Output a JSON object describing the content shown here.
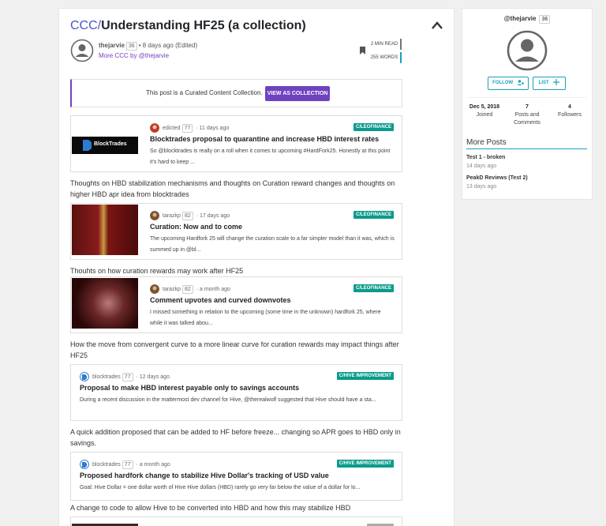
{
  "post": {
    "prefix": "CCC",
    "slash": "/",
    "title_rest": "Understanding HF25 (a collection)",
    "author": "thejarvie",
    "author_rep": "36",
    "age": "• 8 days ago (Edited)",
    "author_sub": "More CCC by @thejarvie",
    "read_time": "2 MIN READ",
    "word_count": "255 WORDS"
  },
  "notice": {
    "text": "This post is a Curated Content Collection.",
    "button": "VIEW AS COLLECTION"
  },
  "cards": [
    {
      "author": "edicted",
      "rep": "77",
      "age": "11 days ago",
      "tag": "C/LEOFINANCE",
      "title": "Blocktrades proposal to quarantine and increase HBD interest rates",
      "desc": "So @blocktrades is really on a roll when it comes to upcoming #HardFork25. Honestly at this point it's hard to keep ...",
      "thumb_text": "BlockTrades"
    },
    {
      "author": "tarazkp",
      "rep": "82",
      "age": "17 days ago",
      "tag": "C/LEOFINANCE",
      "title": "Curation: Now and to come",
      "desc": "The upcoming Hardfork 25 will change the curation scale to a far simpler model than it was, which is summed up in @bl..."
    },
    {
      "author": "tarazkp",
      "rep": "82",
      "age": "a month ago",
      "tag": "C/LEOFINANCE",
      "title": "Comment upvotes and curved downvotes",
      "desc": "I missed something in relation to the upcoming (some time in the unknown) hardfork 25, where while it was talked abou..."
    },
    {
      "author": "blocktrades",
      "rep": "77",
      "age": "12 days ago",
      "tag": "C/HIVE IMPROVEMENT",
      "title": "Proposal to make HBD interest payable only to savings accounts",
      "desc": "During a recent discussion in the mattermost dev channel for Hive, @therealwolf suggested that Hive should have a sta..."
    },
    {
      "author": "blocktrades",
      "rep": "77",
      "age": "a month ago",
      "tag": "C/HIVE IMPROVEMENT",
      "title": "Proposed hardfork change to stabilize Hive Dollar's tracking of USD value",
      "desc": "Goal: Hive Dollar = one dollar worth of Hive Hive dollars (HBD) rarely go very far below the value of a dollar for lo..."
    }
  ],
  "captions": [
    "Thoughts on HBD stabilization mechanisms and thoughts on Curation reward changes and thoughts on higher HBD apr idea from blocktrades",
    "Thouhts on how curation rewards may work after HF25",
    "How the move from convergent curve to a more linear curve for curation rewards may impact things after HF25",
    "A quick addition proposed that can be added to HF before freeze... changing so APR goes to HBD only in savings.",
    "A change to code to allow Hive to be converted into HBD and how this may stabilize HBD"
  ],
  "sidebar": {
    "username": "@thejarvie",
    "rep": "36",
    "follow": "FOLLOW",
    "list": "LIST",
    "joined_value": "Dec 5, 2018",
    "joined_label": "Joined",
    "posts_value": "7",
    "posts_label_1": "Posts and",
    "posts_label_2": "Comments",
    "followers_value": "4",
    "followers_label": "Followers",
    "more_posts": "More Posts",
    "posts": [
      {
        "title": "Test 1 - broken",
        "date": "14 days ago"
      },
      {
        "title": "PeakD Reviews (Test 2)",
        "date": "13 days ago"
      }
    ]
  },
  "colors": {
    "accent": "#6f42c1",
    "teal": "#17a2b8",
    "tag": "#0b9b8b"
  }
}
